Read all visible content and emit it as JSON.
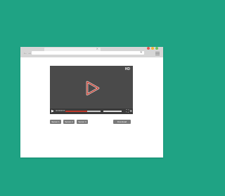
{
  "colors": {
    "background": "#1fa384",
    "window": "#ffffff",
    "chrome": "#d6d6d6",
    "player": "#4a4a4a",
    "accent": "#c0392b",
    "button": "#7a7a7a"
  },
  "browser": {
    "icons": [
      "back-arrow-icon",
      "forward-arrow-icon",
      "star-icon",
      "menu-icon"
    ]
  },
  "player": {
    "badge": "HD",
    "time": "00:00/00:00",
    "progress": 0.62,
    "volume": 1.0
  },
  "buttons": {
    "server_1": "Server 1",
    "server_2": "Server 2",
    "server_3": "Server 3",
    "download": "Download"
  }
}
